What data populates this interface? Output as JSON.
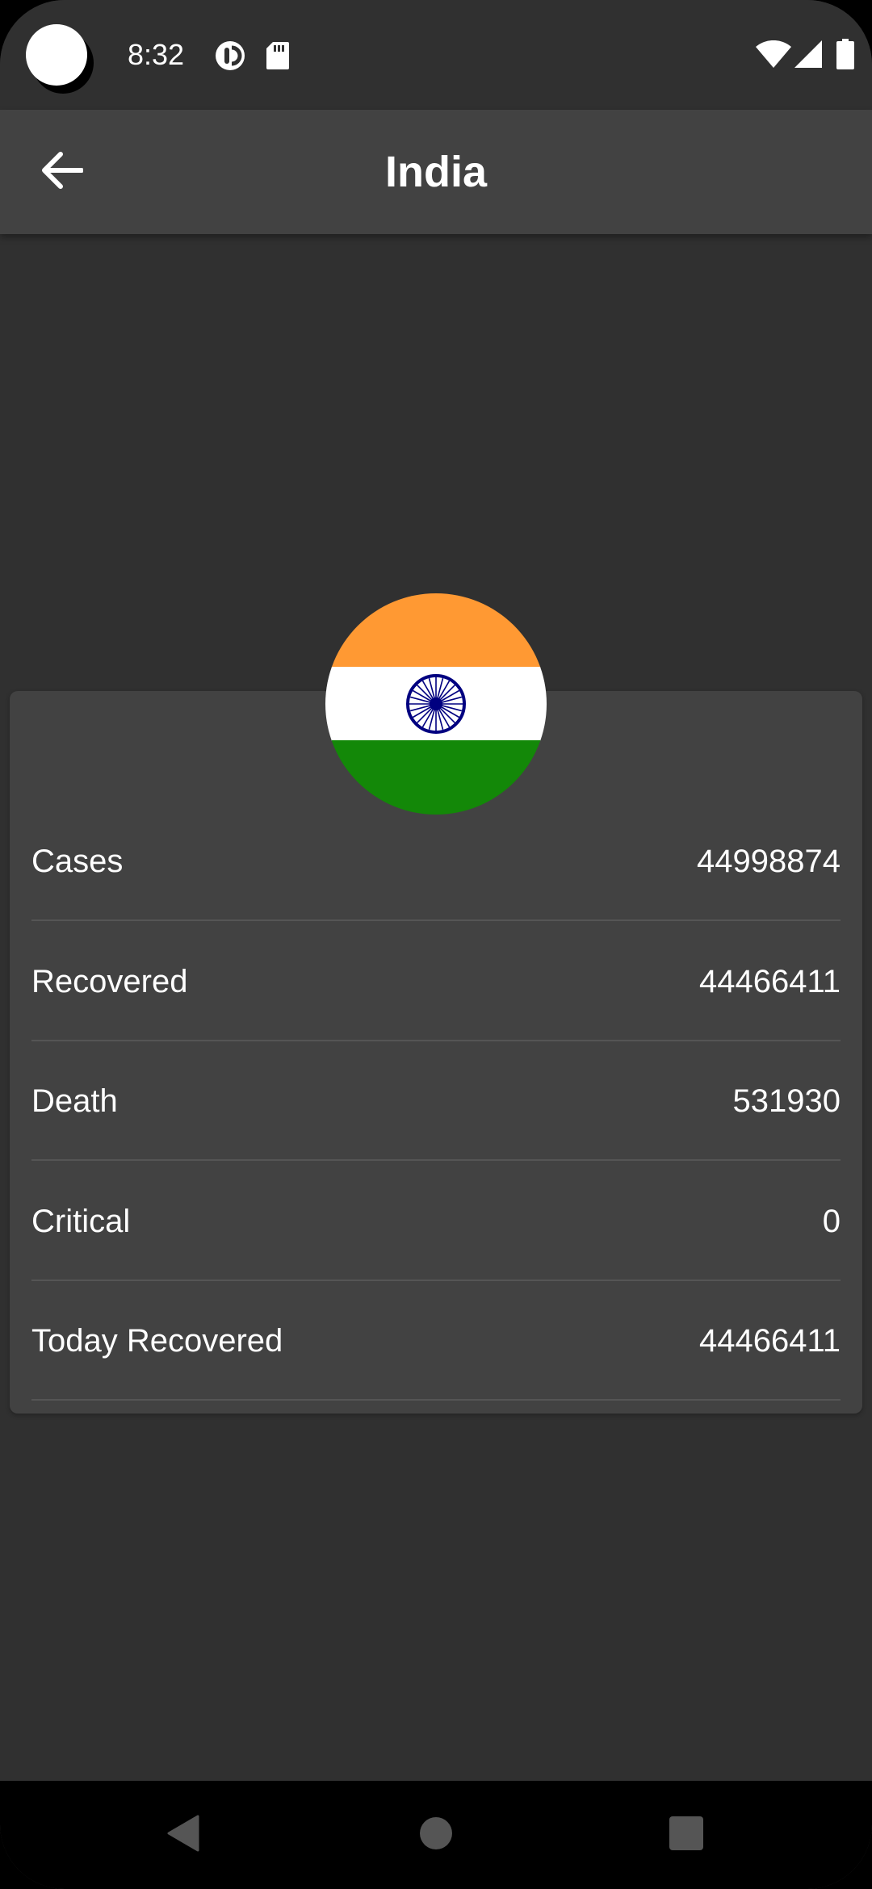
{
  "status_bar": {
    "time": "8:32",
    "icons_left": [
      "data-saver-icon",
      "sd-card-icon"
    ],
    "icons_right": [
      "wifi-icon",
      "cellular-signal-icon",
      "battery-icon"
    ]
  },
  "app_bar": {
    "title": "India",
    "back_icon": "arrow-back-icon"
  },
  "flag": {
    "country": "India",
    "colors": {
      "saffron": "#FF9933",
      "white": "#FFFFFF",
      "green": "#138808",
      "chakra": "#000080"
    }
  },
  "stats": [
    {
      "label": "Cases",
      "value": "44998874"
    },
    {
      "label": "Recovered",
      "value": "44466411"
    },
    {
      "label": "Death",
      "value": "531930"
    },
    {
      "label": "Critical",
      "value": "0"
    },
    {
      "label": "Today Recovered",
      "value": "44466411"
    }
  ],
  "theme": {
    "background": "#303030",
    "surface": "#424242",
    "divider": "#555555",
    "text": "#FFFFFF"
  },
  "nav_bar": {
    "buttons": [
      "back-triangle-icon",
      "home-circle-icon",
      "recents-square-icon"
    ]
  }
}
